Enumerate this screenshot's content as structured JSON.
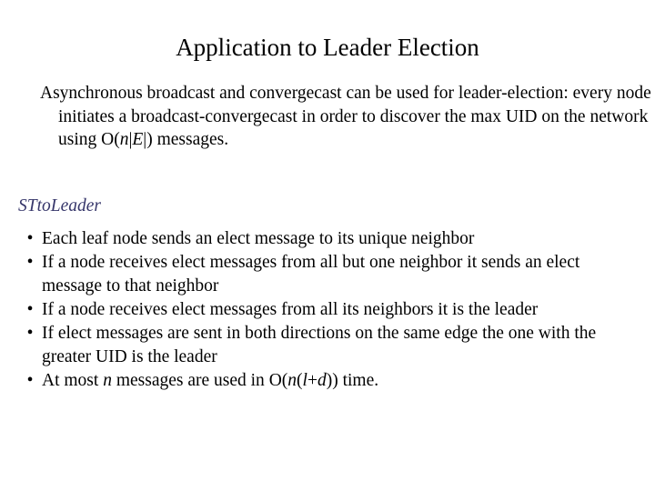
{
  "slide": {
    "title": "Application to Leader Election",
    "intro_paragraph": "Asynchronous broadcast and convergecast can be used for leader-election: every node initiates a broadcast-convergecast in order to discover the max UID on the network using ",
    "intro_math_prefix": "O(",
    "intro_math_n": "n",
    "intro_math_bar1": "|",
    "intro_math_E": "E",
    "intro_math_bar2": "|",
    "intro_math_suffix": ")",
    "intro_paragraph_tail": " messages.",
    "sub_heading": "STtoLeader",
    "bullet_marker": "•",
    "bullets": [
      {
        "text": "Each leaf node sends an elect message to its unique neighbor"
      },
      {
        "text": "If a node receives elect messages from all but one neighbor it sends an elect message to that neighbor"
      },
      {
        "text": "If a node receives elect messages from all its neighbors it is the leader"
      },
      {
        "text": "If elect messages are sent in both directions on the same edge the one with the greater UID is the leader"
      }
    ],
    "bullet_last": {
      "prefix": "At most ",
      "var_n": "n",
      "middle": " messages are used in ",
      "big_o": "O(",
      "o_n": "n",
      "o_paren_open": "(",
      "o_l": "l",
      "o_plus": "+",
      "o_d": "d",
      "o_paren_close": ")",
      "o_close": ")",
      "suffix": " time."
    },
    "colors": {
      "background": "#ffffff",
      "body_text": "#000000",
      "heading_accent": "#37376b"
    }
  }
}
